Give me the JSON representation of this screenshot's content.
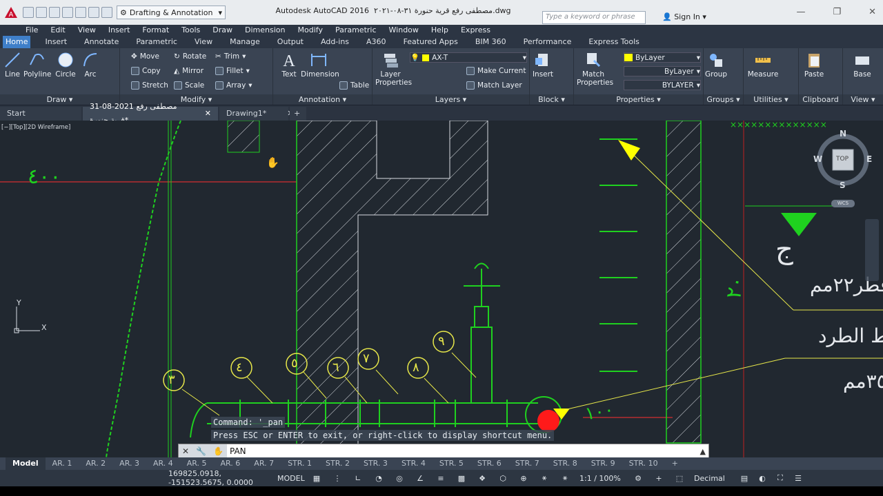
{
  "app": {
    "title": "Autodesk AutoCAD 2016",
    "file": "مصطفى رفع قرية حنورة ٣١-٠٨-٢٠٢١.dwg",
    "workspace": "Drafting & Annotation",
    "search_placeholder": "Type a keyword or phrase",
    "sign_in": "Sign In"
  },
  "menu": [
    "File",
    "Edit",
    "View",
    "Insert",
    "Format",
    "Tools",
    "Draw",
    "Dimension",
    "Modify",
    "Parametric",
    "Window",
    "Help",
    "Express"
  ],
  "ribbon_tabs": [
    "Home",
    "Insert",
    "Annotate",
    "Parametric",
    "View",
    "Manage",
    "Output",
    "Add-ins",
    "A360",
    "Featured Apps",
    "BIM 360",
    "Performance",
    "Express Tools"
  ],
  "panels": {
    "draw": {
      "title": "Draw",
      "line": "Line",
      "polyline": "Polyline",
      "circle": "Circle",
      "arc": "Arc"
    },
    "modify": {
      "title": "Modify",
      "move": "Move",
      "rotate": "Rotate",
      "trim": "Trim",
      "copy": "Copy",
      "mirror": "Mirror",
      "fillet": "Fillet",
      "stretch": "Stretch",
      "scale": "Scale",
      "array": "Array"
    },
    "annotation": {
      "title": "Annotation",
      "text": "Text",
      "dimension": "Dimension",
      "table": "Table"
    },
    "layers": {
      "title": "Layers",
      "layer_properties": "Layer Properties",
      "current_layer": "AX-T",
      "make_current": "Make Current",
      "match_layer": "Match Layer"
    },
    "block": {
      "title": "Block",
      "insert": "Insert"
    },
    "properties": {
      "title": "Properties",
      "match": "Match Properties",
      "color": "ByLayer",
      "linetype": "ByLayer",
      "lineweight": "BYLAYER"
    },
    "groups": {
      "title": "Groups",
      "group": "Group"
    },
    "utilities": {
      "title": "Utilities",
      "measure": "Measure"
    },
    "clipboard": {
      "title": "Clipboard",
      "paste": "Paste"
    },
    "view": {
      "title": "View",
      "base": "Base"
    }
  },
  "doc_tabs": [
    "Start",
    "31-08-2021 مصطفى رفع قرية حنورة*",
    "Drawing1*"
  ],
  "viewport_label": "[−][Top][2D Wireframe]",
  "viewcube": {
    "top": "TOP",
    "n": "N",
    "s": "S",
    "e": "E",
    "w": "W",
    "wcs": "WCS"
  },
  "ucs": {
    "x": "X",
    "y": "Y"
  },
  "drawing_text": {
    "dim_left": "٤٠٠",
    "dim_bottom": "١٠٠",
    "dim_right": "٢٠",
    "label_j": "ج",
    "note1": "قطر٢٢مم",
    "note2": "ط الطرد",
    "note3": "٣٥٠مم",
    "balloons": [
      "٣",
      "٤",
      "٥",
      "٦",
      "٧",
      "٨",
      "٩"
    ]
  },
  "command_history": [
    "Command: '_pan",
    "Press ESC or ENTER to exit, or right-click to display shortcut menu."
  ],
  "command_input": "PAN",
  "layout_tabs": [
    "Model",
    "AR. 1",
    "AR. 2",
    "AR. 3",
    "AR. 4",
    "AR. 5",
    "AR. 6",
    "AR. 7",
    "STR. 1",
    "STR. 2",
    "STR. 3",
    "STR. 4",
    "STR. 5",
    "STR. 6",
    "STR. 7",
    "STR. 8",
    "STR. 9",
    "STR. 10"
  ],
  "status": {
    "coords": "169825.0918, -151523.5675, 0.0000",
    "model": "MODEL",
    "scale": "1:1 / 100%",
    "units": "Decimal"
  },
  "colors": {
    "green": "#1fd11f",
    "yellow": "#e8e84a",
    "red": "#ff1a1a",
    "canvas": "#212830",
    "accent": "#3f7fc9"
  }
}
